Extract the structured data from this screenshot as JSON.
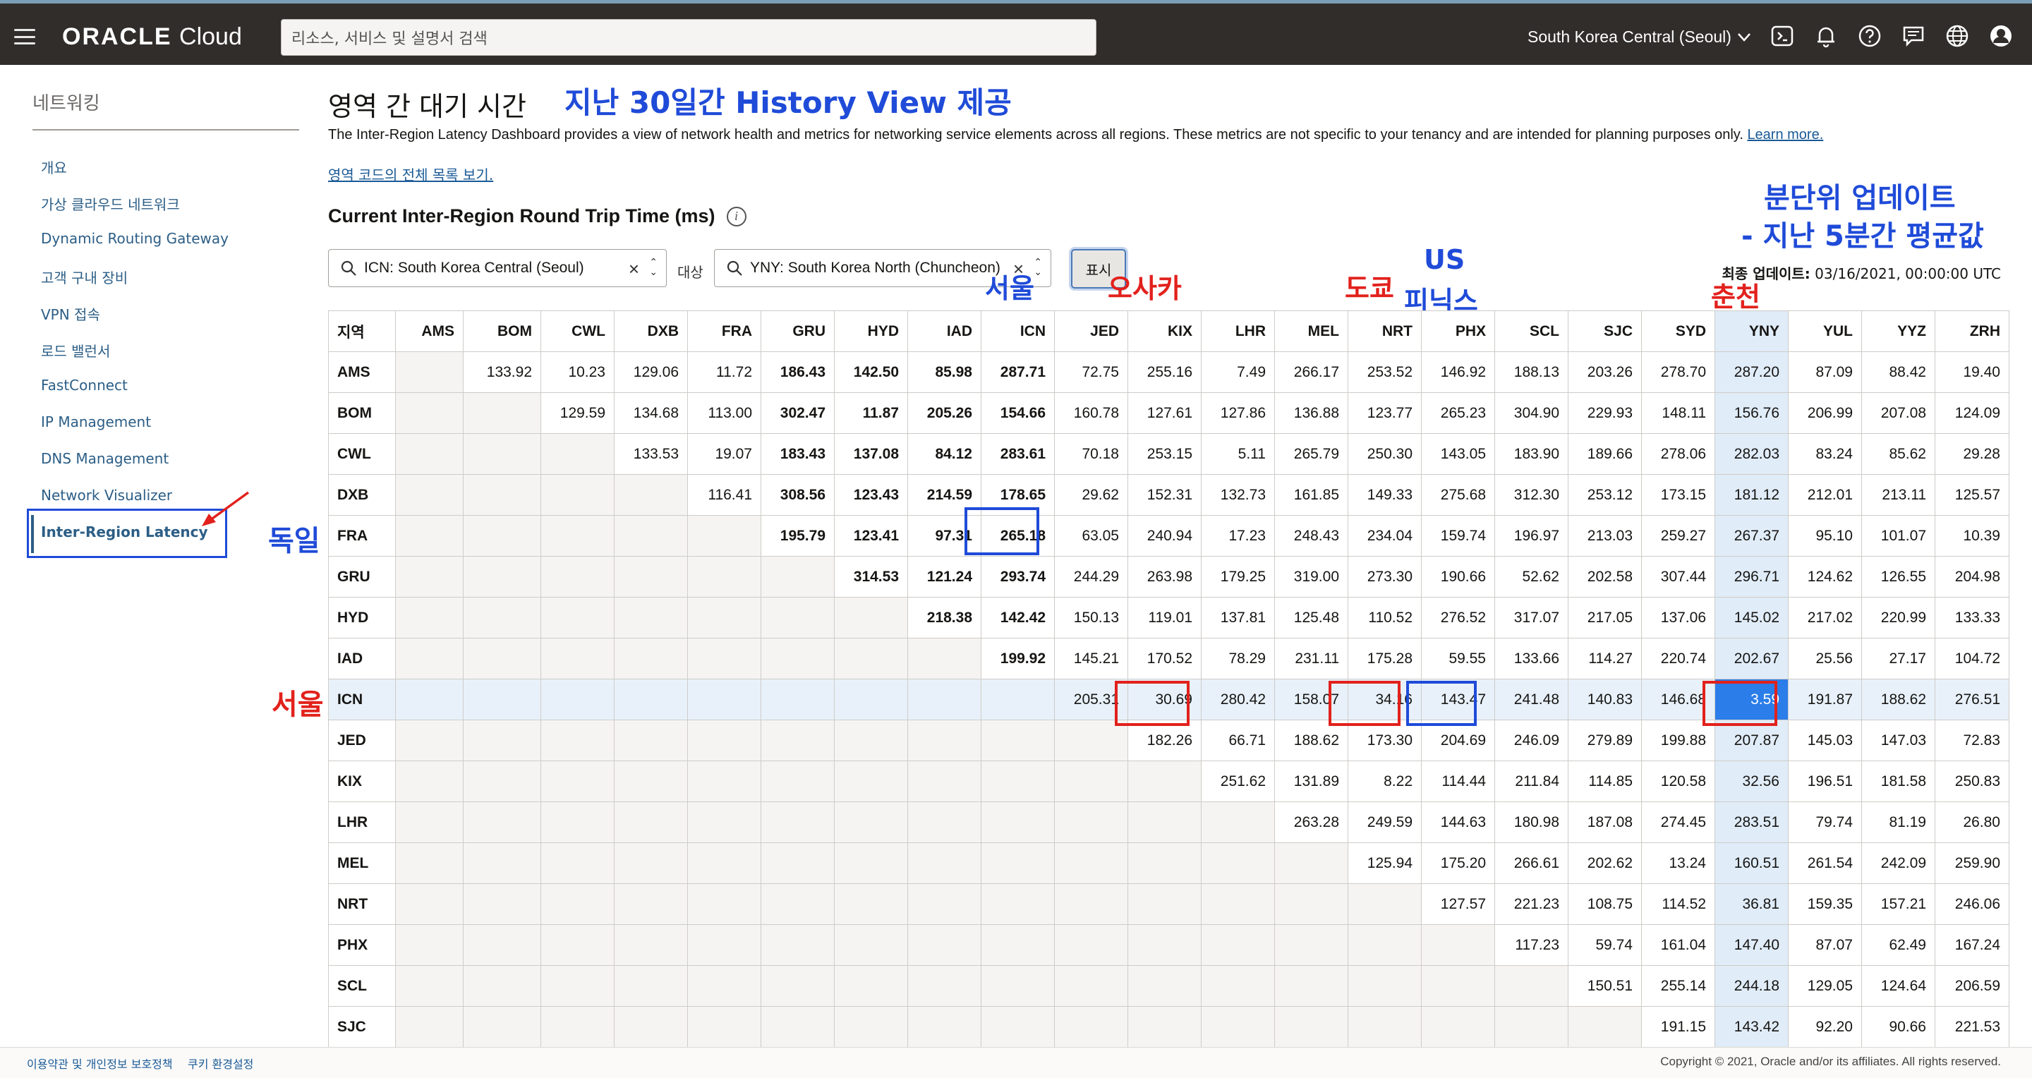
{
  "header": {
    "logo_bold": "ORACLE",
    "logo_light": "Cloud",
    "search_placeholder": "리소스, 서비스 및 설명서 검색",
    "region": "South Korea Central (Seoul)",
    "icons": [
      "terminal-icon",
      "bell-icon",
      "help-icon",
      "chat-icon",
      "globe-icon",
      "user-icon"
    ]
  },
  "sidebar": {
    "title": "네트워킹",
    "items": [
      {
        "label": "개요"
      },
      {
        "label": "가상 클라우드 네트워크"
      },
      {
        "label": "Dynamic Routing Gateway"
      },
      {
        "label": "고객 구내 장비"
      },
      {
        "label": "VPN 접속"
      },
      {
        "label": "로드 밸런서"
      },
      {
        "label": "FastConnect"
      },
      {
        "label": "IP Management"
      },
      {
        "label": "DNS Management"
      },
      {
        "label": "Network Visualizer"
      },
      {
        "label": "Inter-Region Latency"
      }
    ]
  },
  "main": {
    "title": "영역 간 대기 시간",
    "description": "The Inter-Region Latency Dashboard provides a view of network health and metrics for networking service elements across all regions. These metrics are not specific to your tenancy and are intended for planning purposes only.",
    "learn_more": "Learn more.",
    "region_codes_link": "영역 코드의 전체 목록 보기.",
    "section_title": "Current Inter-Region Round Trip Time (ms)",
    "source_value": "ICN: South Korea Central (Seoul)",
    "target_label": "대상",
    "target_value": "YNY: South Korea North (Chuncheon)",
    "show_button": "표시",
    "updated_label": "최종 업데이트:",
    "updated_value": "03/16/2021, 00:00:00 UTC"
  },
  "table": {
    "corner": "지역",
    "columns": [
      "AMS",
      "BOM",
      "CWL",
      "DXB",
      "FRA",
      "GRU",
      "HYD",
      "IAD",
      "ICN",
      "JED",
      "KIX",
      "LHR",
      "MEL",
      "NRT",
      "PHX",
      "SCL",
      "SJC",
      "SYD",
      "YNY",
      "YUL",
      "YYZ",
      "ZRH"
    ],
    "rows": [
      {
        "name": "AMS",
        "start": 1,
        "values": [
          "133.92",
          "10.23",
          "129.06",
          "11.72",
          "186.43",
          "142.50",
          "85.98",
          "287.71",
          "72.75",
          "255.16",
          "7.49",
          "266.17",
          "253.52",
          "146.92",
          "188.13",
          "203.26",
          "278.70",
          "287.20",
          "87.09",
          "88.42",
          "19.40"
        ]
      },
      {
        "name": "BOM",
        "start": 2,
        "values": [
          "129.59",
          "134.68",
          "113.00",
          "302.47",
          "11.87",
          "205.26",
          "154.66",
          "160.78",
          "127.61",
          "127.86",
          "136.88",
          "123.77",
          "265.23",
          "304.90",
          "229.93",
          "148.11",
          "156.76",
          "206.99",
          "207.08",
          "124.09"
        ]
      },
      {
        "name": "CWL",
        "start": 3,
        "values": [
          "133.53",
          "19.07",
          "183.43",
          "137.08",
          "84.12",
          "283.61",
          "70.18",
          "253.15",
          "5.11",
          "265.79",
          "250.30",
          "143.05",
          "183.90",
          "189.66",
          "278.06",
          "282.03",
          "83.24",
          "85.62",
          "29.28"
        ]
      },
      {
        "name": "DXB",
        "start": 4,
        "values": [
          "116.41",
          "308.56",
          "123.43",
          "214.59",
          "178.65",
          "29.62",
          "152.31",
          "132.73",
          "161.85",
          "149.33",
          "275.68",
          "312.30",
          "253.12",
          "173.15",
          "181.12",
          "212.01",
          "213.11",
          "125.57"
        ]
      },
      {
        "name": "FRA",
        "start": 5,
        "values": [
          "195.79",
          "123.41",
          "97.31",
          "265.18",
          "63.05",
          "240.94",
          "17.23",
          "248.43",
          "234.04",
          "159.74",
          "196.97",
          "213.03",
          "259.27",
          "267.37",
          "95.10",
          "101.07",
          "10.39"
        ]
      },
      {
        "name": "GRU",
        "start": 6,
        "values": [
          "314.53",
          "121.24",
          "293.74",
          "244.29",
          "263.98",
          "179.25",
          "319.00",
          "273.30",
          "190.66",
          "52.62",
          "202.58",
          "307.44",
          "296.71",
          "124.62",
          "126.55",
          "204.98"
        ]
      },
      {
        "name": "HYD",
        "start": 7,
        "values": [
          "218.38",
          "142.42",
          "150.13",
          "119.01",
          "137.81",
          "125.48",
          "110.52",
          "276.52",
          "317.07",
          "217.05",
          "137.06",
          "145.02",
          "217.02",
          "220.99",
          "133.33"
        ]
      },
      {
        "name": "IAD",
        "start": 8,
        "values": [
          "199.92",
          "145.21",
          "170.52",
          "78.29",
          "231.11",
          "175.28",
          "59.55",
          "133.66",
          "114.27",
          "220.74",
          "202.67",
          "25.56",
          "27.17",
          "104.72"
        ]
      },
      {
        "name": "ICN",
        "start": 9,
        "values": [
          "205.31",
          "30.69",
          "280.42",
          "158.07",
          "34.16",
          "143.47",
          "241.48",
          "140.83",
          "146.68",
          "3.59",
          "191.87",
          "188.62",
          "276.51"
        ]
      },
      {
        "name": "JED",
        "start": 10,
        "values": [
          "182.26",
          "66.71",
          "188.62",
          "173.30",
          "204.69",
          "246.09",
          "279.89",
          "199.88",
          "207.87",
          "145.03",
          "147.03",
          "72.83"
        ]
      },
      {
        "name": "KIX",
        "start": 11,
        "values": [
          "251.62",
          "131.89",
          "8.22",
          "114.44",
          "211.84",
          "114.85",
          "120.58",
          "32.56",
          "196.51",
          "181.58",
          "250.83"
        ]
      },
      {
        "name": "LHR",
        "start": 12,
        "values": [
          "263.28",
          "249.59",
          "144.63",
          "180.98",
          "187.08",
          "274.45",
          "283.51",
          "79.74",
          "81.19",
          "26.80"
        ]
      },
      {
        "name": "MEL",
        "start": 13,
        "values": [
          "125.94",
          "175.20",
          "266.61",
          "202.62",
          "13.24",
          "160.51",
          "261.54",
          "242.09",
          "259.90"
        ]
      },
      {
        "name": "NRT",
        "start": 14,
        "values": [
          "127.57",
          "221.23",
          "108.75",
          "114.52",
          "36.81",
          "159.35",
          "157.21",
          "246.06"
        ]
      },
      {
        "name": "PHX",
        "start": 15,
        "values": [
          "117.23",
          "59.74",
          "161.04",
          "147.40",
          "87.07",
          "62.49",
          "167.24"
        ]
      },
      {
        "name": "SCL",
        "start": 16,
        "values": [
          "150.51",
          "255.14",
          "244.18",
          "129.05",
          "124.64",
          "206.59"
        ]
      },
      {
        "name": "SJC",
        "start": 17,
        "values": [
          "191.15",
          "143.42",
          "92.20",
          "90.66",
          "221.53"
        ]
      }
    ],
    "bold_columns": [
      "GRU",
      "HYD",
      "IAD",
      "ICN"
    ],
    "highlight_row": "ICN",
    "selected_column": "YNY"
  },
  "annotations": {
    "history": "지난 30일간 History View 제공",
    "minute_update_1": "분단위 업데이트",
    "minute_update_2": "- 지난 5분간 평균값",
    "seoul_col": "서울",
    "osaka": "오사카",
    "tokyo": "도쿄",
    "us": "US",
    "phoenix": "피닉스",
    "chuncheon": "춘천",
    "germany": "독일",
    "seoul_row": "서울"
  },
  "footer": {
    "terms": "이용약관 및 개인정보 보호정책",
    "cookies": "쿠키 환경설정",
    "copyright": "Copyright © 2021, Oracle and/or its affiliates. All rights reserved."
  }
}
